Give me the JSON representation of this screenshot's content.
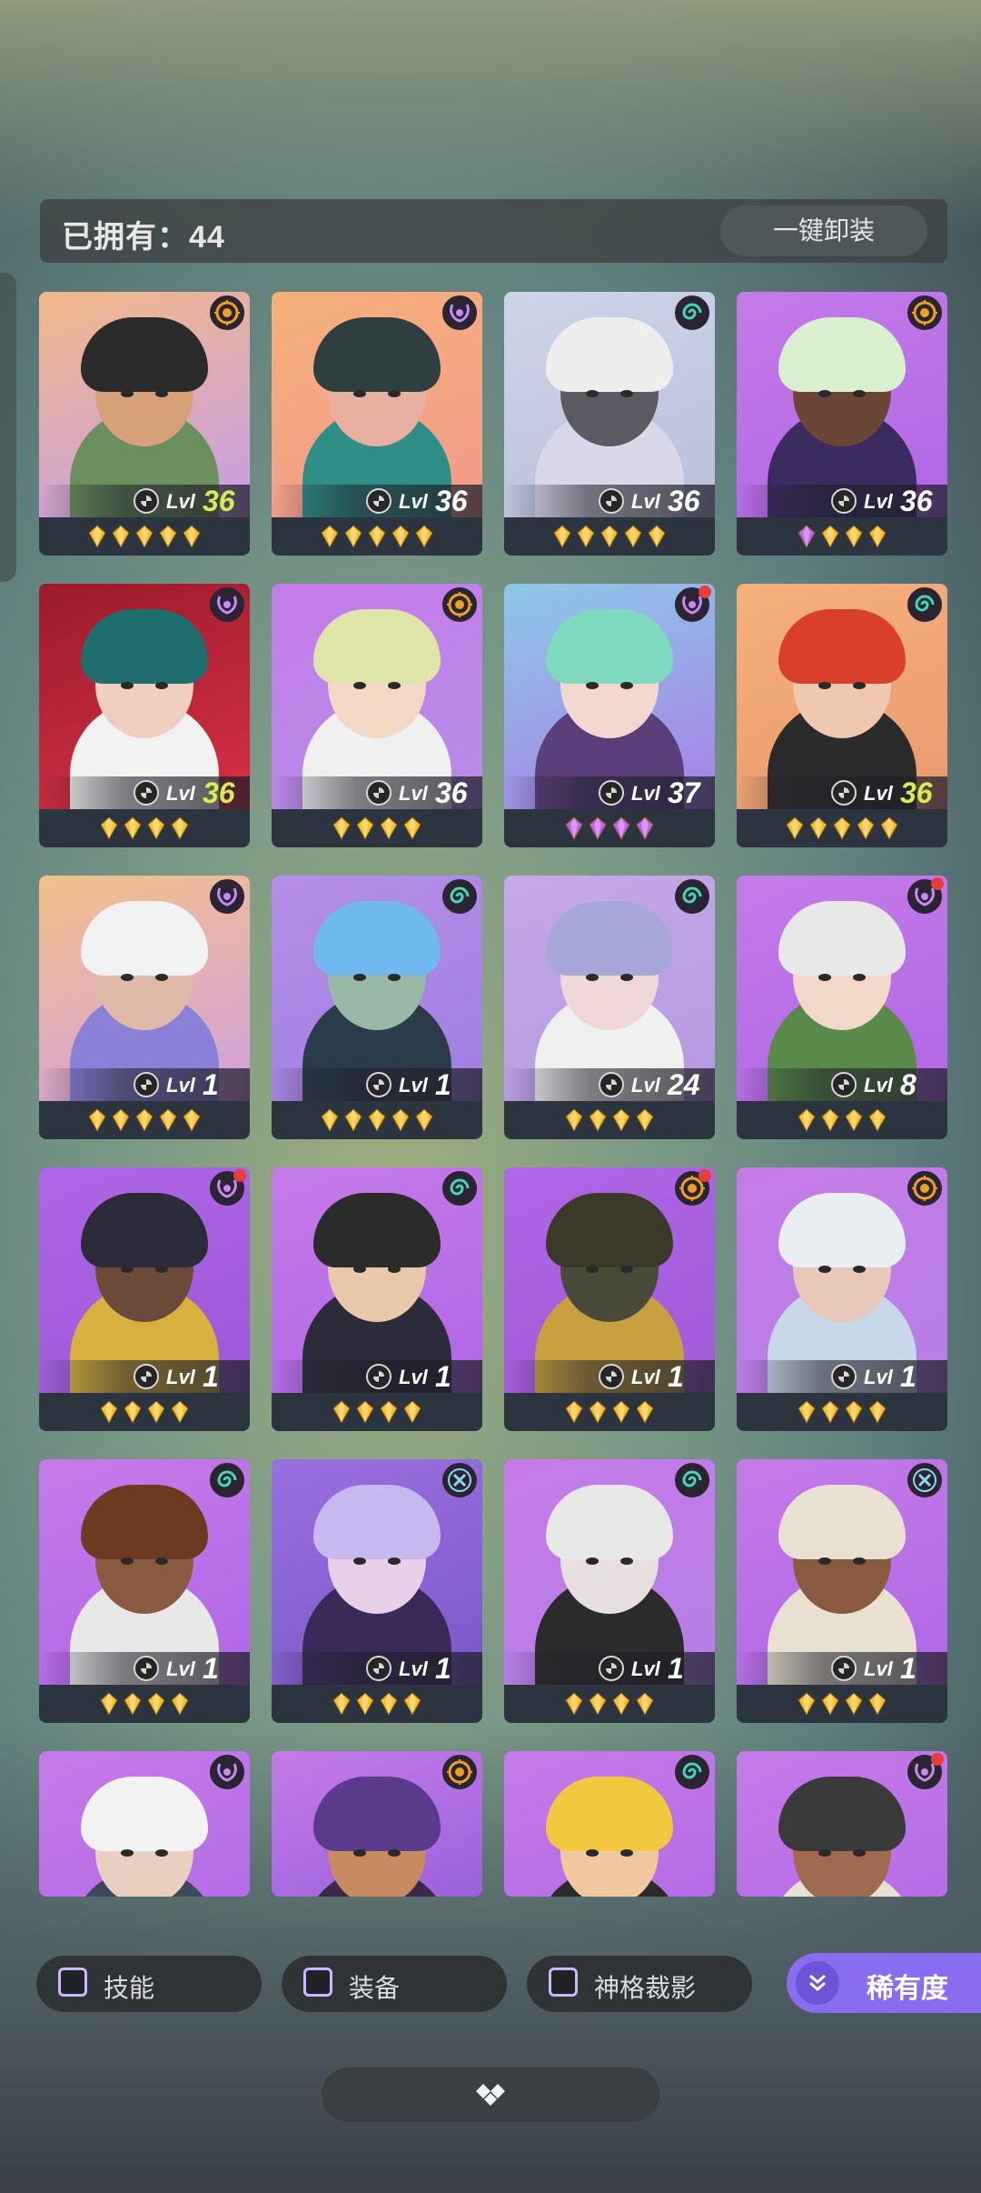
{
  "owned": {
    "label": "已拥有：44",
    "unequip_all_label": "一键卸装"
  },
  "heroes": [
    {
      "emblem": "sun",
      "lvl_prefix": "Lvl",
      "level": "36",
      "max": true,
      "stars": 5,
      "gem": "gold",
      "dot": false,
      "bg": [
        "#f2b989",
        "#c79de8"
      ],
      "hair": "#2b2b2b",
      "skin": "#d7a17a",
      "cloth": "#6b8f5e"
    },
    {
      "emblem": "horns",
      "lvl_prefix": "Lvl",
      "level": "36",
      "max": false,
      "stars": 5,
      "gem": "gold",
      "dot": false,
      "bg": [
        "#f6b07a",
        "#f19a8d"
      ],
      "hair": "#2f3f3f",
      "skin": "#e8b0a0",
      "cloth": "#2f8f86"
    },
    {
      "emblem": "spiral",
      "lvl_prefix": "Lvl",
      "level": "36",
      "max": false,
      "stars": 5,
      "gem": "gold",
      "dot": false,
      "bg": [
        "#cfd5e8",
        "#b8bfd8"
      ],
      "hair": "#eeeeee",
      "skin": "#5b5b64",
      "cloth": "#d8d8e8"
    },
    {
      "emblem": "sun",
      "lvl_prefix": "Lvl",
      "level": "36",
      "max": false,
      "stars": 4,
      "gem": "mixed",
      "dot": false,
      "bg": [
        "#c57be8",
        "#b066e6"
      ],
      "hair": "#d9efd0",
      "skin": "#6b4637",
      "cloth": "#3b2b5e"
    },
    {
      "emblem": "horns",
      "lvl_prefix": "Lvl",
      "level": "36",
      "max": true,
      "stars": 4,
      "gem": "gold",
      "dot": false,
      "bg": [
        "#9a1b2b",
        "#d83048"
      ],
      "hair": "#1f6d6d",
      "skin": "#f0cfc0",
      "cloth": "#f2f2f2"
    },
    {
      "emblem": "sun",
      "lvl_prefix": "Lvl",
      "level": "36",
      "max": false,
      "stars": 4,
      "gem": "gold",
      "dot": false,
      "bg": [
        "#c57be8",
        "#b58ee8"
      ],
      "hair": "#dfe5a8",
      "skin": "#f2d8c5",
      "cloth": "#f0f0f0"
    },
    {
      "emblem": "horns",
      "lvl_prefix": "Lvl",
      "level": "37",
      "max": false,
      "stars": 4,
      "gem": "purple",
      "dot": true,
      "bg": [
        "#8ec8e8",
        "#a77fe8"
      ],
      "hair": "#7fd8c0",
      "skin": "#f2d8d0",
      "cloth": "#5a3f7a"
    },
    {
      "emblem": "spiral",
      "lvl_prefix": "Lvl",
      "level": "36",
      "max": true,
      "stars": 5,
      "gem": "gold",
      "dot": false,
      "bg": [
        "#f5b07a",
        "#e99a70"
      ],
      "hair": "#d8402b",
      "skin": "#f0c8b0",
      "cloth": "#2b2b2b"
    },
    {
      "emblem": "horns",
      "lvl_prefix": "Lvl",
      "level": "1",
      "max": false,
      "stars": 5,
      "gem": "gold",
      "dot": false,
      "bg": [
        "#f5c08a",
        "#d0a0e0"
      ],
      "hair": "#f2f2f2",
      "skin": "#e0b8a8",
      "cloth": "#8a80d8"
    },
    {
      "emblem": "spiral",
      "lvl_prefix": "Lvl",
      "level": "1",
      "max": false,
      "stars": 5,
      "gem": "gold",
      "dot": false,
      "bg": [
        "#b48ee8",
        "#9f7fe0"
      ],
      "hair": "#6fb8f0",
      "skin": "#9ab8a8",
      "cloth": "#2b3b4a"
    },
    {
      "emblem": "spiral",
      "lvl_prefix": "Lvl",
      "level": "24",
      "max": false,
      "stars": 4,
      "gem": "gold",
      "dot": false,
      "bg": [
        "#c7a8e8",
        "#b49ae0"
      ],
      "hair": "#a8a8d8",
      "skin": "#f0d8d8",
      "cloth": "#f0f0f0"
    },
    {
      "emblem": "horns",
      "lvl_prefix": "Lvl",
      "level": "8",
      "max": false,
      "stars": 4,
      "gem": "gold",
      "dot": true,
      "bg": [
        "#c57be8",
        "#b066e6"
      ],
      "hair": "#e8e8e8",
      "skin": "#f2d8c8",
      "cloth": "#5a8a4a"
    },
    {
      "emblem": "horns",
      "lvl_prefix": "Lvl",
      "level": "1",
      "max": false,
      "stars": 4,
      "gem": "gold",
      "dot": true,
      "bg": [
        "#b066e6",
        "#9a58d8"
      ],
      "hair": "#2b2b3a",
      "skin": "#6b4a3a",
      "cloth": "#d8b040"
    },
    {
      "emblem": "spiral",
      "lvl_prefix": "Lvl",
      "level": "1",
      "max": false,
      "stars": 4,
      "gem": "gold",
      "dot": false,
      "bg": [
        "#c57be8",
        "#b066e6"
      ],
      "hair": "#2b2b2b",
      "skin": "#e8c8a8",
      "cloth": "#2b2b3a"
    },
    {
      "emblem": "sun",
      "lvl_prefix": "Lvl",
      "level": "1",
      "max": false,
      "stars": 4,
      "gem": "gold",
      "dot": true,
      "bg": [
        "#b066e6",
        "#a05ad8"
      ],
      "hair": "#3b3a2a",
      "skin": "#4a4a3a",
      "cloth": "#c8a040"
    },
    {
      "emblem": "sun",
      "lvl_prefix": "Lvl",
      "level": "1",
      "max": false,
      "stars": 4,
      "gem": "gold",
      "dot": false,
      "bg": [
        "#c57be8",
        "#b57fe6"
      ],
      "hair": "#e8eef2",
      "skin": "#e8c8b8",
      "cloth": "#c8d8e8"
    },
    {
      "emblem": "spiral",
      "lvl_prefix": "Lvl",
      "level": "1",
      "max": false,
      "stars": 4,
      "gem": "gold",
      "dot": false,
      "bg": [
        "#c57be8",
        "#b066e6"
      ],
      "hair": "#6b3a20",
      "skin": "#8a5a40",
      "cloth": "#e8e8e8"
    },
    {
      "emblem": "cross",
      "lvl_prefix": "Lvl",
      "level": "1",
      "max": false,
      "stars": 4,
      "gem": "gold",
      "dot": false,
      "bg": [
        "#9a70e0",
        "#7a58c8"
      ],
      "hair": "#c8b8f0",
      "skin": "#e8d0e8",
      "cloth": "#3a2a5a"
    },
    {
      "emblem": "spiral",
      "lvl_prefix": "Lvl",
      "level": "1",
      "max": false,
      "stars": 4,
      "gem": "gold",
      "dot": false,
      "bg": [
        "#c57be8",
        "#b57fe6"
      ],
      "hair": "#e8e8e8",
      "skin": "#e8e0e0",
      "cloth": "#2b2b2b"
    },
    {
      "emblem": "cross",
      "lvl_prefix": "Lvl",
      "level": "1",
      "max": false,
      "stars": 4,
      "gem": "gold",
      "dot": false,
      "bg": [
        "#c57be8",
        "#b066e6"
      ],
      "hair": "#e8e0d0",
      "skin": "#8a5a40",
      "cloth": "#e8e0d0"
    },
    {
      "emblem": "horns",
      "lvl_prefix": "",
      "level": "",
      "max": false,
      "stars": 0,
      "gem": "gold",
      "dot": false,
      "bg": [
        "#c57be8",
        "#b066e6"
      ],
      "hair": "#f2f2f2",
      "skin": "#e8d0c0",
      "cloth": "#3a4a5a"
    },
    {
      "emblem": "sun",
      "lvl_prefix": "",
      "level": "",
      "max": false,
      "stars": 0,
      "gem": "gold",
      "dot": false,
      "bg": [
        "#c57be8",
        "#8a58d8"
      ],
      "hair": "#5a3a8a",
      "skin": "#c88a60",
      "cloth": "#3a2a4a"
    },
    {
      "emblem": "spiral",
      "lvl_prefix": "",
      "level": "",
      "max": false,
      "stars": 0,
      "gem": "gold",
      "dot": false,
      "bg": [
        "#c57be8",
        "#b066e6"
      ],
      "hair": "#f2c840",
      "skin": "#f0c8a0",
      "cloth": "#2b2b2b"
    },
    {
      "emblem": "horns",
      "lvl_prefix": "",
      "level": "",
      "max": false,
      "stars": 0,
      "gem": "gold",
      "dot": true,
      "bg": [
        "#c57be8",
        "#b066e6"
      ],
      "hair": "#3a3a3a",
      "skin": "#a06a50",
      "cloth": "#e8e0d0"
    }
  ],
  "filters": {
    "skill_label": "技能",
    "equip_label": "装备",
    "sculpt_label": "神格裁影",
    "rarity_label": "稀有度"
  },
  "colors": {
    "max_level": "#d6ec52",
    "gem_gold": "#f4c030",
    "gem_purple": "#c060f0",
    "accent": "#8a6cf0"
  }
}
